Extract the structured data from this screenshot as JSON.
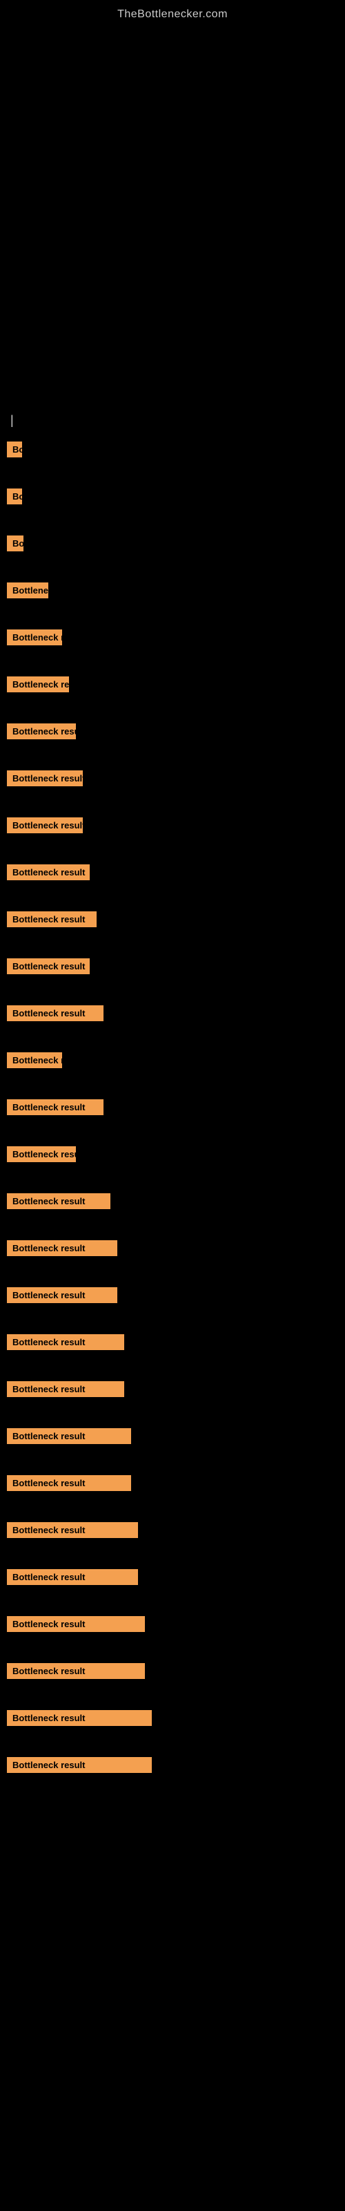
{
  "site": {
    "title": "TheBottlenecker.com"
  },
  "cursor": "|",
  "items": [
    {
      "id": 1,
      "label": "Bottleneck result",
      "width_class": "w-20"
    },
    {
      "id": 2,
      "label": "Bottleneck result",
      "width_class": "w-22"
    },
    {
      "id": 3,
      "label": "Bottleneck result",
      "width_class": "w-24"
    },
    {
      "id": 4,
      "label": "Bottleneck result",
      "width_class": "w-60"
    },
    {
      "id": 5,
      "label": "Bottleneck result",
      "width_class": "w-80"
    },
    {
      "id": 6,
      "label": "Bottleneck result",
      "width_class": "w-90"
    },
    {
      "id": 7,
      "label": "Bottleneck result",
      "width_class": "w-100"
    },
    {
      "id": 8,
      "label": "Bottleneck result",
      "width_class": "w-110"
    },
    {
      "id": 9,
      "label": "Bottleneck result",
      "width_class": "w-110"
    },
    {
      "id": 10,
      "label": "Bottleneck result",
      "width_class": "w-120"
    },
    {
      "id": 11,
      "label": "Bottleneck result",
      "width_class": "w-130"
    },
    {
      "id": 12,
      "label": "Bottleneck result",
      "width_class": "w-120"
    },
    {
      "id": 13,
      "label": "Bottleneck result",
      "width_class": "w-140"
    },
    {
      "id": 14,
      "label": "Bottleneck result",
      "width_class": "w-80"
    },
    {
      "id": 15,
      "label": "Bottleneck result",
      "width_class": "w-140"
    },
    {
      "id": 16,
      "label": "Bottleneck result",
      "width_class": "w-100"
    },
    {
      "id": 17,
      "label": "Bottleneck result",
      "width_class": "w-150"
    },
    {
      "id": 18,
      "label": "Bottleneck result",
      "width_class": "w-160"
    },
    {
      "id": 19,
      "label": "Bottleneck result",
      "width_class": "w-160"
    },
    {
      "id": 20,
      "label": "Bottleneck result",
      "width_class": "w-170"
    },
    {
      "id": 21,
      "label": "Bottleneck result",
      "width_class": "w-170"
    },
    {
      "id": 22,
      "label": "Bottleneck result",
      "width_class": "w-180"
    },
    {
      "id": 23,
      "label": "Bottleneck result",
      "width_class": "w-180"
    },
    {
      "id": 24,
      "label": "Bottleneck result",
      "width_class": "w-190"
    },
    {
      "id": 25,
      "label": "Bottleneck result",
      "width_class": "w-190"
    },
    {
      "id": 26,
      "label": "Bottleneck result",
      "width_class": "w-200"
    },
    {
      "id": 27,
      "label": "Bottleneck result",
      "width_class": "w-200"
    },
    {
      "id": 28,
      "label": "Bottleneck result",
      "width_class": "w-210"
    },
    {
      "id": 29,
      "label": "Bottleneck result",
      "width_class": "w-210"
    }
  ]
}
